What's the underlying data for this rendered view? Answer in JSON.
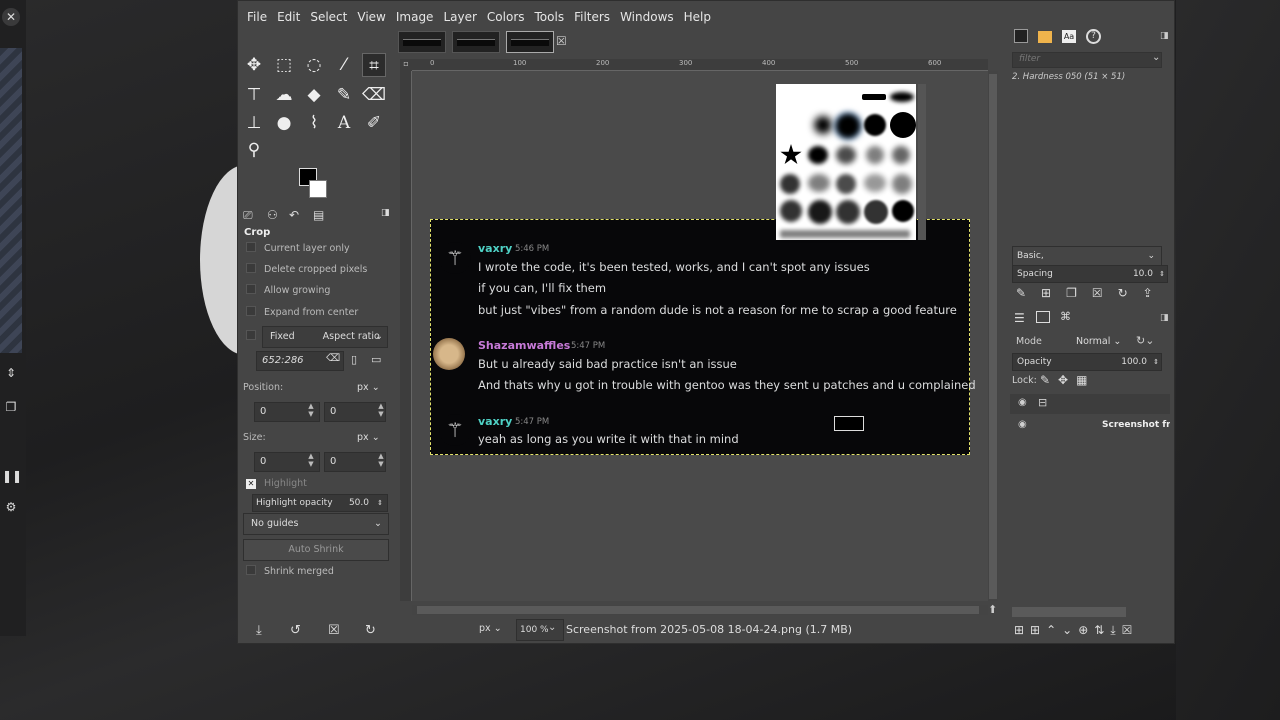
{
  "app": {
    "menus": [
      "File",
      "Edit",
      "Select",
      "View",
      "Image",
      "Layer",
      "Colors",
      "Tools",
      "Filters",
      "Windows",
      "Help"
    ]
  },
  "tool_options": {
    "title": "Crop",
    "current_layer_only": "Current layer only",
    "delete_cropped": "Delete cropped pixels",
    "allow_growing": "Allow growing",
    "expand_from_center": "Expand from center",
    "fixed": "Fixed",
    "aspect_ratio": "Aspect ratio",
    "ratio_value": "652:286",
    "position_label": "Position:",
    "size_label": "Size:",
    "unit": "px",
    "pos_x": "0",
    "pos_y": "0",
    "size_w": "0",
    "size_h": "0",
    "highlight": "Highlight",
    "highlight_opacity_label": "Highlight opacity",
    "highlight_opacity_value": "50.0",
    "guides": "No guides",
    "auto_shrink": "Auto Shrink",
    "shrink_merged": "Shrink merged"
  },
  "ruler": {
    "top_labels": [
      "0",
      "100",
      "200",
      "300",
      "400",
      "500",
      "600"
    ]
  },
  "chat": {
    "messages": [
      {
        "user": "vaxry",
        "time": "5:46 PM",
        "color": "#4fd1c5",
        "lines": [
          "I wrote the code, it's been tested, works, and I can't spot any issues",
          "if you can, I'll fix them",
          "but just \"vibes\" from a random dude is not a reason for me to scrap a good feature"
        ]
      },
      {
        "user": "Shazamwaffles",
        "time": "5:47 PM",
        "color": "#c77ad8",
        "lines": [
          "But u already said bad practice isn't an issue",
          "And thats why u got in trouble with gentoo was they sent u patches and u complained"
        ]
      },
      {
        "user": "vaxry",
        "time": "5:47 PM",
        "color": "#4fd1c5",
        "lines": [
          "yeah as long as you write it with that in mind"
        ]
      }
    ]
  },
  "status": {
    "unit": "px",
    "zoom": "100 %",
    "file": "Screenshot from 2025-05-08 18-04-24.png (1.7 MB)"
  },
  "dock": {
    "filter_placeholder": "filter",
    "brush_name": "2. Hardness 050 (51 × 51)",
    "brush_set": "Basic,",
    "spacing_label": "Spacing",
    "spacing_value": "10.0",
    "mode_label": "Mode",
    "mode_value": "Normal",
    "opacity_label": "Opacity",
    "opacity_value": "100.0",
    "lock_label": "Lock:",
    "layer_name": "Screenshot fro"
  }
}
